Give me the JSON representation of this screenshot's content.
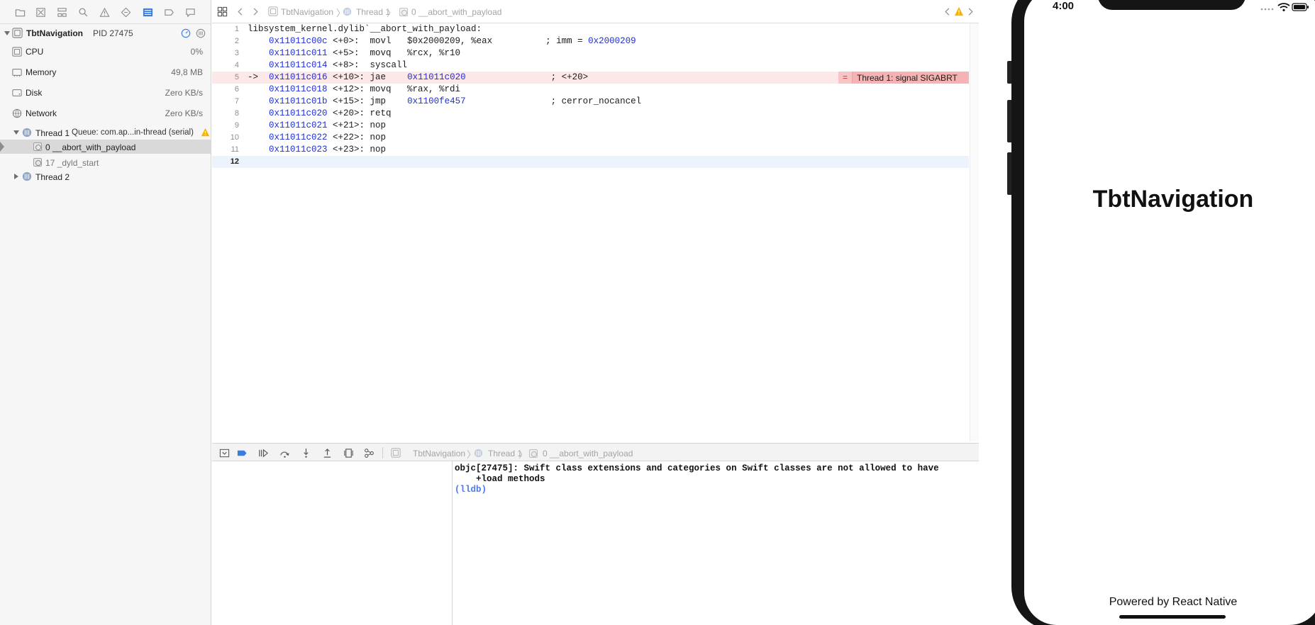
{
  "navigator": {
    "process": {
      "name": "TbtNavigation",
      "pid": "PID 27475"
    },
    "gauges": [
      {
        "label": "CPU",
        "value": "0%"
      },
      {
        "label": "Memory",
        "value": "49,8 MB"
      },
      {
        "label": "Disk",
        "value": "Zero KB/s"
      },
      {
        "label": "Network",
        "value": "Zero KB/s"
      }
    ],
    "thread1": {
      "name": "Thread 1",
      "queue": "Queue: com.ap...in-thread (serial)"
    },
    "frames": [
      {
        "label": "0 __abort_with_payload"
      },
      {
        "label": "17 _dyld_start"
      }
    ],
    "thread2": {
      "name": "Thread 2"
    }
  },
  "jumpbar": {
    "crumbs": [
      "TbtNavigation",
      "Thread 1",
      "0 __abort_with_payload"
    ]
  },
  "editor": {
    "lines": [
      {
        "num": "1",
        "text": "libsystem_kernel.dylib`__abort_with_payload:"
      },
      {
        "num": "2",
        "prefix": "    ",
        "addr": "0x11011c00c",
        "rest": " <+0>:  movl   $0x2000209, %eax          ; imm = ",
        "hex": "0x2000209"
      },
      {
        "num": "3",
        "prefix": "    ",
        "addr": "0x11011c011",
        "rest": " <+5>:  movq   %rcx, %r10"
      },
      {
        "num": "4",
        "prefix": "    ",
        "addr": "0x11011c014",
        "rest": " <+8>:  syscall"
      },
      {
        "num": "5",
        "prefix": "->  ",
        "addr": "0x11011c016",
        "rest": " <+10>: jae    ",
        "hex": "0x11011c020",
        "tail": "                ; <+20>"
      },
      {
        "num": "6",
        "prefix": "    ",
        "addr": "0x11011c018",
        "rest": " <+12>: movq   %rax, %rdi"
      },
      {
        "num": "7",
        "prefix": "    ",
        "addr": "0x11011c01b",
        "rest": " <+15>: jmp    ",
        "hex": "0x1100fe457",
        "tail": "                ; cerror_nocancel"
      },
      {
        "num": "8",
        "prefix": "    ",
        "addr": "0x11011c020",
        "rest": " <+20>: retq"
      },
      {
        "num": "9",
        "prefix": "    ",
        "addr": "0x11011c021",
        "rest": " <+21>: nop"
      },
      {
        "num": "10",
        "prefix": "    ",
        "addr": "0x11011c022",
        "rest": " <+22>: nop"
      },
      {
        "num": "11",
        "prefix": "    ",
        "addr": "0x11011c023",
        "rest": " <+23>: nop"
      },
      {
        "num": "12",
        "text": ""
      }
    ],
    "error_badge": {
      "symbol": "=",
      "message": "Thread 1: signal SIGABRT"
    }
  },
  "debugbar": {
    "crumbs": [
      "TbtNavigation",
      "Thread 1",
      "0 __abort_with_payload"
    ]
  },
  "console": {
    "output": "objc[27475]: Swift class extensions and categories on Swift classes are not allowed to have\n    +load methods",
    "prompt": "(lldb)"
  },
  "simulator": {
    "time": "4:00",
    "title": "TbtNavigation",
    "footer": "Powered by React Native"
  },
  "colors": {
    "accent": "#3b7ddd",
    "error_line": "#fde8e8",
    "error_badge": "#f7b3b3",
    "address": "#1e2fd8",
    "warning": "#f5b400"
  }
}
